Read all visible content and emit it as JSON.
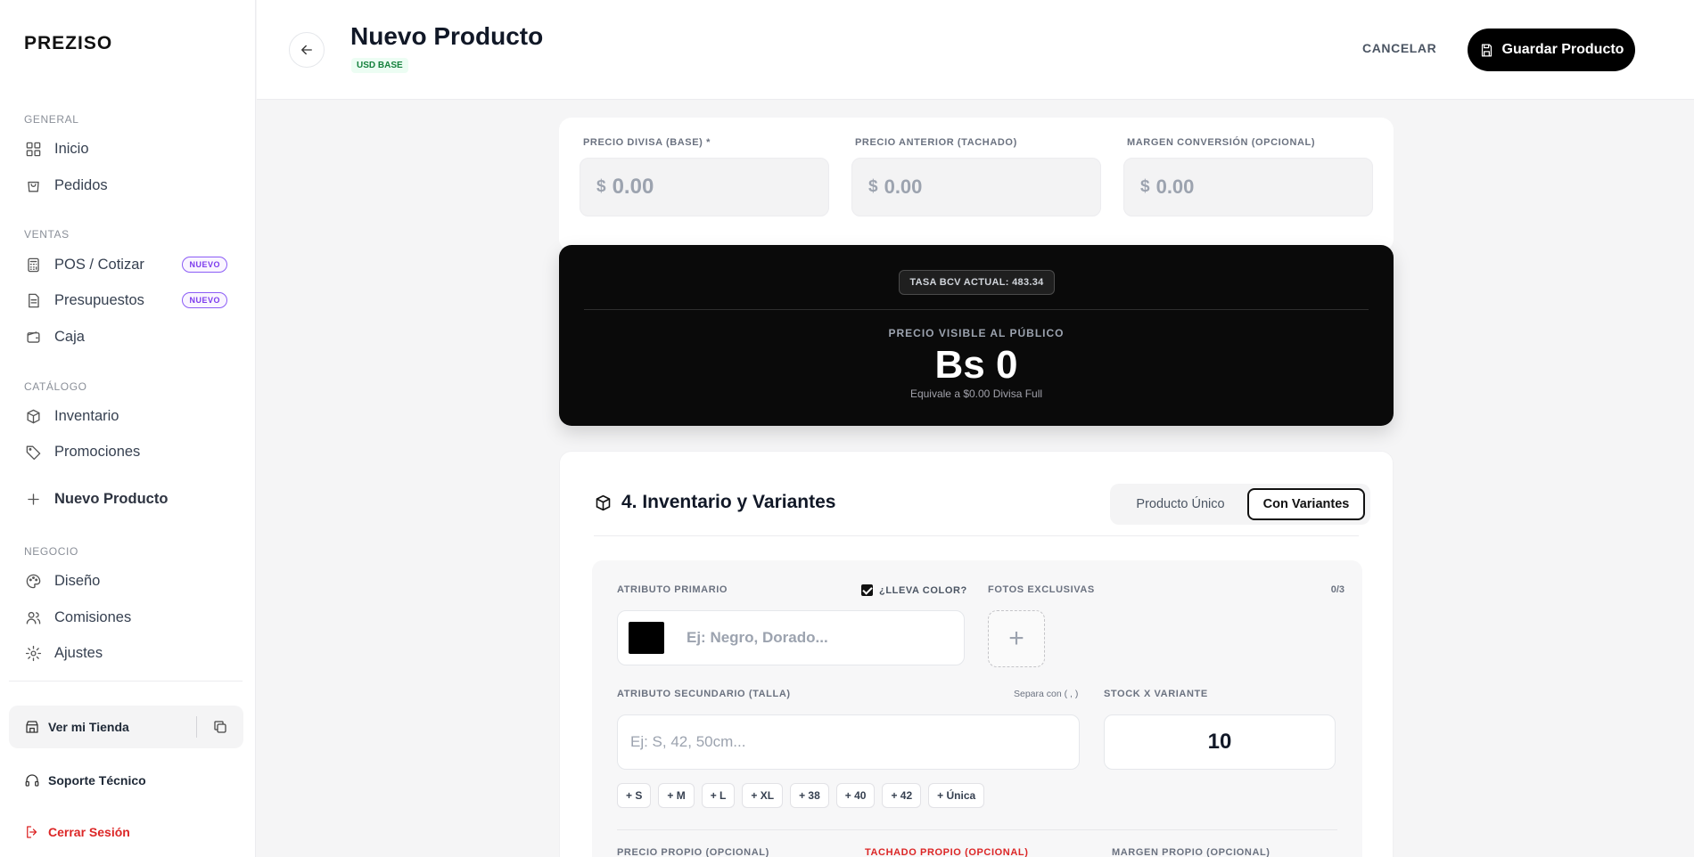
{
  "app": {
    "logo": "PREZISO"
  },
  "sidebar": {
    "sections": {
      "general": "GENERAL",
      "ventas": "VENTAS",
      "catalogo": "CATÁLOGO",
      "negocio": "NEGOCIO"
    },
    "items": {
      "inicio": "Inicio",
      "pedidos": "Pedidos",
      "pos": "POS / Cotizar",
      "presupuestos": "Presupuestos",
      "caja": "Caja",
      "inventario": "Inventario",
      "promociones": "Promociones",
      "nuevo_producto": "Nuevo Producto",
      "diseno": "Diseño",
      "comisiones": "Comisiones",
      "ajustes": "Ajustes"
    },
    "badge_new": "NUEVO",
    "store_link": "Ver mi Tienda",
    "support": "Soporte Técnico",
    "logout": "Cerrar Sesión"
  },
  "header": {
    "title": "Nuevo Producto",
    "badge": "USD BASE",
    "cancel": "CANCELAR",
    "save": "Guardar Producto"
  },
  "pricing": {
    "base": {
      "label": "PRECIO DIVISA (BASE) *",
      "currency": "$",
      "placeholder": "0.00"
    },
    "previous": {
      "label": "PRECIO ANTERIOR (TACHADO)",
      "currency": "$",
      "placeholder": "0.00"
    },
    "margin": {
      "label": "MARGEN CONVERSIÓN (OPCIONAL)",
      "currency": "$",
      "placeholder": "0.00"
    }
  },
  "public_price": {
    "rate": "TASA BCV ACTUAL: 483.34",
    "label": "PRECIO VISIBLE AL PÚBLICO",
    "value": "Bs 0",
    "equivalent": "Equivale a $0.00 Divisa Full"
  },
  "inventory": {
    "title": "4. Inventario y Variantes",
    "toggle": {
      "single": "Producto Único",
      "variants": "Con Variantes"
    },
    "primary_label": "ATRIBUTO PRIMARIO",
    "has_color": "¿LLEVA COLOR?",
    "photos_label": "FOTOS EXCLUSIVAS",
    "photos_count": "0/3",
    "primary_placeholder": "Ej: Negro, Dorado...",
    "photo_add": "+",
    "secondary_label": "ATRIBUTO SECUNDARIO (TALLA)",
    "separator_hint": "Separa con ( , )",
    "secondary_placeholder": "Ej: S, 42, 50cm...",
    "stock_label": "STOCK X VARIANTE",
    "stock_value": "10",
    "size_chips": [
      "+ S",
      "+ M",
      "+ L",
      "+ XL",
      "+ 38",
      "+ 40",
      "+ 42",
      "+ Única"
    ],
    "own_price_label": "PRECIO PROPIO (OPCIONAL)",
    "own_strike_label": "TACHADO PROPIO (OPCIONAL)",
    "own_margin_label": "MARGEN PROPIO (OPCIONAL)"
  },
  "colors": {
    "accent": "#000000",
    "new_badge": "#7c3aed",
    "usd_badge": "#15803d",
    "danger": "#dc2626"
  }
}
